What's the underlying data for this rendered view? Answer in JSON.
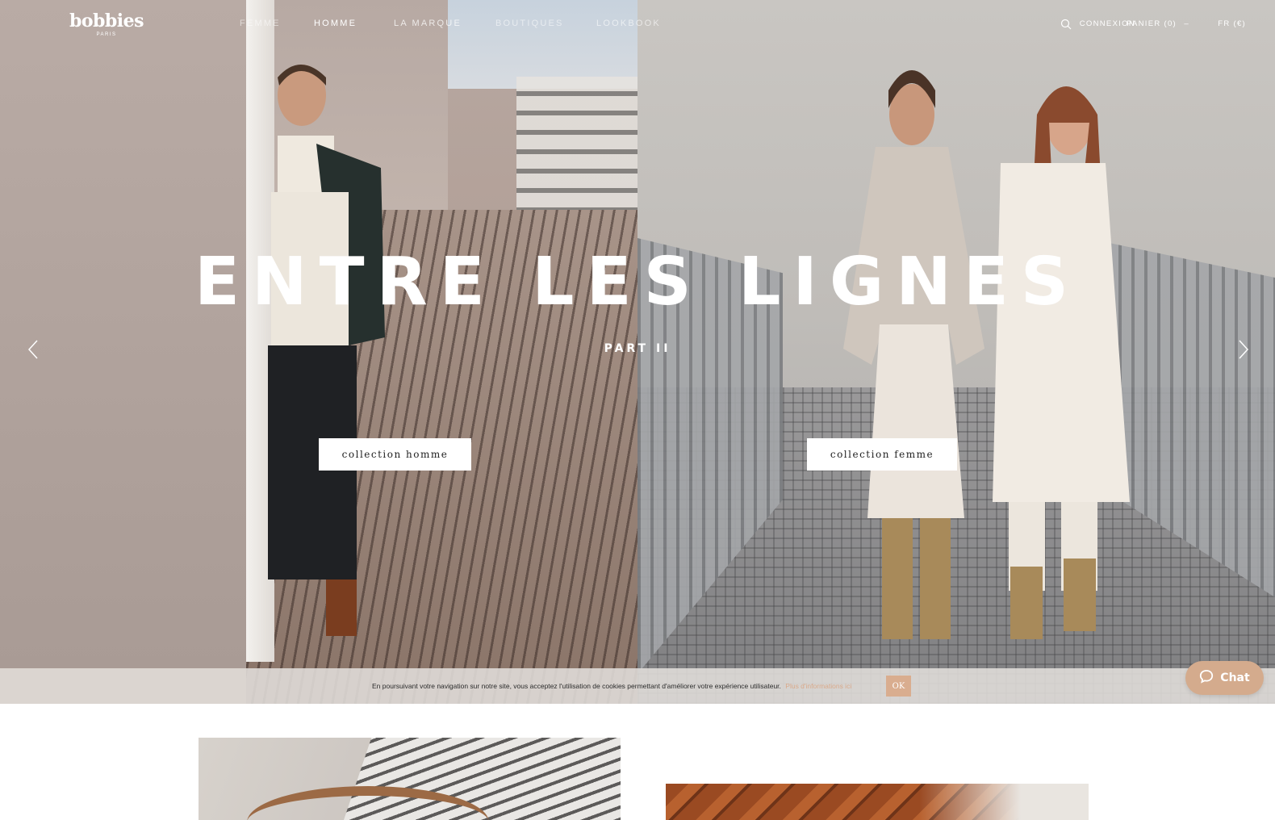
{
  "header": {
    "logo": {
      "brand": "bobbies",
      "sub": "PARIS"
    },
    "nav": [
      "FEMME",
      "HOMME",
      "LA MARQUE",
      "BOUTIQUES",
      "LOOKBOOK"
    ],
    "utility": {
      "connexion": "CONNEXION",
      "panier": "PANIER (0)",
      "separator": "–",
      "language": "FR (€)"
    }
  },
  "hero": {
    "title": "ENTRE LES LIGNES",
    "subtitle": "PART II",
    "cta_homme": "collection homme",
    "cta_femme": "collection femme"
  },
  "cookie_bar": {
    "message": "En poursuivant votre navigation sur notre site, vous acceptez l'utilisation de cookies permettant d'améliorer votre expérience utilisateur.",
    "more_link": "Plus d'informations ici",
    "ok_label": "OK"
  },
  "chat": {
    "label": "Chat"
  },
  "colors": {
    "accent": "#d4ab8d",
    "text_dark": "#2b2b2b",
    "link": "#d9a98a"
  },
  "icons": [
    "search-icon",
    "chevron-left-icon",
    "chevron-right-icon",
    "chat-bubble-icon"
  ]
}
